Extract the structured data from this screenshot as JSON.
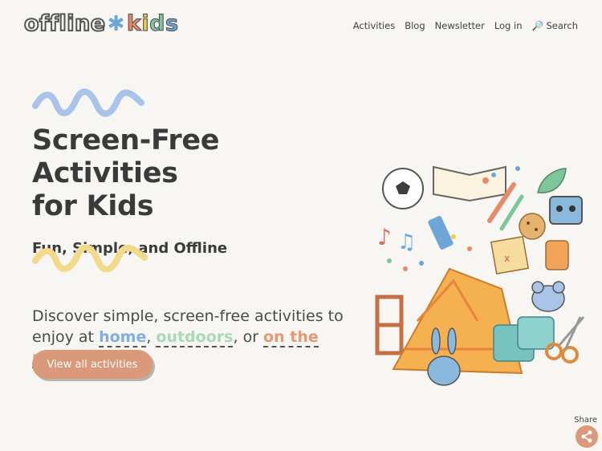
{
  "logo": {
    "word1": "offline",
    "word2": "kids"
  },
  "nav": {
    "activities": "Activities",
    "blog": "Blog",
    "newsletter": "Newsletter",
    "login": "Log in",
    "search": "Search"
  },
  "hero": {
    "title_line1": "Screen-Free Activities",
    "title_line2": "for Kids",
    "subtitle": "Fun, Simple, and Offline",
    "desc_pre": "Discover simple, screen-free activities to enjoy at ",
    "link_home": "home",
    "sep1": ", ",
    "link_outdoors": "outdoors",
    "sep2": ", or ",
    "link_move": "on the move",
    "desc_end": ".",
    "cta": "View all activities"
  },
  "share": {
    "label": "Share"
  },
  "colors": {
    "accent_blue": "#7faee0",
    "accent_green": "#a9d9b5",
    "accent_orange": "#e49a6e",
    "button": "#d9997a",
    "squiggle_blue": "#a9c4e8",
    "squiggle_yellow": "#f3d98a"
  },
  "icons": [
    "search-icon",
    "share-icon",
    "star-icon"
  ]
}
